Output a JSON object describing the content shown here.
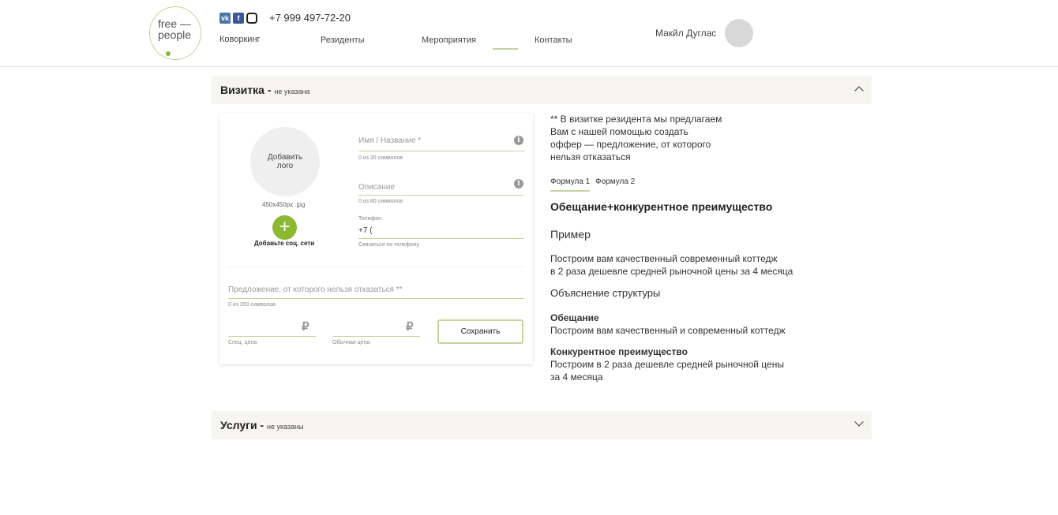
{
  "header": {
    "logo_text": [
      "free —",
      "people"
    ],
    "social": [
      "vk",
      "f",
      "ig"
    ],
    "phone": "+7 999 497-72-20",
    "nav": [
      "Коворкинг",
      "Резиденты",
      "Мероприятия",
      "Контакты"
    ],
    "user_name": "Макйл Дуглас"
  },
  "vizitka": {
    "title": "Визитка -",
    "status": "не указана",
    "logo_button": "Добавить лого",
    "logo_hint": "450x450px .jpg",
    "social_add": "Добавьте соц. сети",
    "name_placeholder": "Имя / Название *",
    "name_counter": "0 из 30 символов",
    "desc_placeholder": "Описание",
    "desc_counter": "0 из 80 символов",
    "phone_label": "Телефон",
    "phone_value": "+7 (",
    "phone_hint": "Связаться по телефону",
    "offer_placeholder": "Предложение, от которого нельзя отказаться **",
    "offer_counter": "0 из 200 символов",
    "currency": "₽",
    "special_price": "Спец. цена",
    "regular_price": "Обычная цена",
    "save": "Сохранить"
  },
  "help": {
    "intro": [
      "** В визитке резидента мы предлагаем",
      "Вам с нашей помощью создать",
      "оффер — предложение, от которого",
      "нельзя отказаться"
    ],
    "tabs": [
      "Формула 1",
      "Формула 2"
    ],
    "heading": "Обещание+конкурентное преимущество",
    "example_title": "Пример",
    "example": [
      "Построим вам качественный современный коттедж",
      "в 2 раза дешевле средней рыночной цены за 4 месяца"
    ],
    "structure_title": "Объяснение структуры",
    "promise_title": "Обещание",
    "promise_text": "Построим вам качественный и современный коттедж",
    "advantage_title": "Конкурентное преимущество",
    "advantage_text": [
      "Построим в 2 раза дешевле средней рыночной цены",
      "за 4 месяца"
    ]
  },
  "services": {
    "title": "Услуги -",
    "status": "не указаны"
  }
}
